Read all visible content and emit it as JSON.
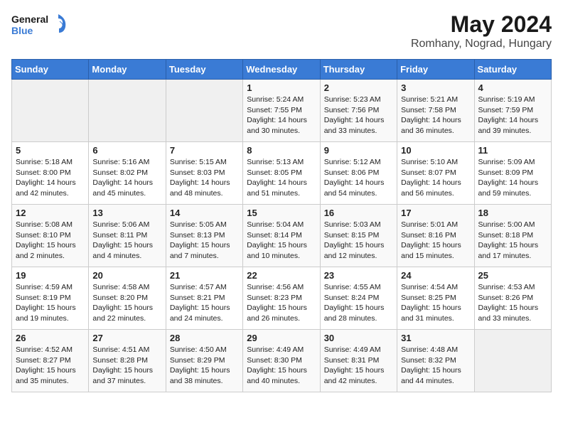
{
  "header": {
    "logo_line1": "General",
    "logo_line2": "Blue",
    "title": "May 2024",
    "subtitle": "Romhany, Nograd, Hungary"
  },
  "weekdays": [
    "Sunday",
    "Monday",
    "Tuesday",
    "Wednesday",
    "Thursday",
    "Friday",
    "Saturday"
  ],
  "weeks": [
    [
      {
        "day": "",
        "info": ""
      },
      {
        "day": "",
        "info": ""
      },
      {
        "day": "",
        "info": ""
      },
      {
        "day": "1",
        "info": "Sunrise: 5:24 AM\nSunset: 7:55 PM\nDaylight: 14 hours\nand 30 minutes."
      },
      {
        "day": "2",
        "info": "Sunrise: 5:23 AM\nSunset: 7:56 PM\nDaylight: 14 hours\nand 33 minutes."
      },
      {
        "day": "3",
        "info": "Sunrise: 5:21 AM\nSunset: 7:58 PM\nDaylight: 14 hours\nand 36 minutes."
      },
      {
        "day": "4",
        "info": "Sunrise: 5:19 AM\nSunset: 7:59 PM\nDaylight: 14 hours\nand 39 minutes."
      }
    ],
    [
      {
        "day": "5",
        "info": "Sunrise: 5:18 AM\nSunset: 8:00 PM\nDaylight: 14 hours\nand 42 minutes."
      },
      {
        "day": "6",
        "info": "Sunrise: 5:16 AM\nSunset: 8:02 PM\nDaylight: 14 hours\nand 45 minutes."
      },
      {
        "day": "7",
        "info": "Sunrise: 5:15 AM\nSunset: 8:03 PM\nDaylight: 14 hours\nand 48 minutes."
      },
      {
        "day": "8",
        "info": "Sunrise: 5:13 AM\nSunset: 8:05 PM\nDaylight: 14 hours\nand 51 minutes."
      },
      {
        "day": "9",
        "info": "Sunrise: 5:12 AM\nSunset: 8:06 PM\nDaylight: 14 hours\nand 54 minutes."
      },
      {
        "day": "10",
        "info": "Sunrise: 5:10 AM\nSunset: 8:07 PM\nDaylight: 14 hours\nand 56 minutes."
      },
      {
        "day": "11",
        "info": "Sunrise: 5:09 AM\nSunset: 8:09 PM\nDaylight: 14 hours\nand 59 minutes."
      }
    ],
    [
      {
        "day": "12",
        "info": "Sunrise: 5:08 AM\nSunset: 8:10 PM\nDaylight: 15 hours\nand 2 minutes."
      },
      {
        "day": "13",
        "info": "Sunrise: 5:06 AM\nSunset: 8:11 PM\nDaylight: 15 hours\nand 4 minutes."
      },
      {
        "day": "14",
        "info": "Sunrise: 5:05 AM\nSunset: 8:13 PM\nDaylight: 15 hours\nand 7 minutes."
      },
      {
        "day": "15",
        "info": "Sunrise: 5:04 AM\nSunset: 8:14 PM\nDaylight: 15 hours\nand 10 minutes."
      },
      {
        "day": "16",
        "info": "Sunrise: 5:03 AM\nSunset: 8:15 PM\nDaylight: 15 hours\nand 12 minutes."
      },
      {
        "day": "17",
        "info": "Sunrise: 5:01 AM\nSunset: 8:16 PM\nDaylight: 15 hours\nand 15 minutes."
      },
      {
        "day": "18",
        "info": "Sunrise: 5:00 AM\nSunset: 8:18 PM\nDaylight: 15 hours\nand 17 minutes."
      }
    ],
    [
      {
        "day": "19",
        "info": "Sunrise: 4:59 AM\nSunset: 8:19 PM\nDaylight: 15 hours\nand 19 minutes."
      },
      {
        "day": "20",
        "info": "Sunrise: 4:58 AM\nSunset: 8:20 PM\nDaylight: 15 hours\nand 22 minutes."
      },
      {
        "day": "21",
        "info": "Sunrise: 4:57 AM\nSunset: 8:21 PM\nDaylight: 15 hours\nand 24 minutes."
      },
      {
        "day": "22",
        "info": "Sunrise: 4:56 AM\nSunset: 8:23 PM\nDaylight: 15 hours\nand 26 minutes."
      },
      {
        "day": "23",
        "info": "Sunrise: 4:55 AM\nSunset: 8:24 PM\nDaylight: 15 hours\nand 28 minutes."
      },
      {
        "day": "24",
        "info": "Sunrise: 4:54 AM\nSunset: 8:25 PM\nDaylight: 15 hours\nand 31 minutes."
      },
      {
        "day": "25",
        "info": "Sunrise: 4:53 AM\nSunset: 8:26 PM\nDaylight: 15 hours\nand 33 minutes."
      }
    ],
    [
      {
        "day": "26",
        "info": "Sunrise: 4:52 AM\nSunset: 8:27 PM\nDaylight: 15 hours\nand 35 minutes."
      },
      {
        "day": "27",
        "info": "Sunrise: 4:51 AM\nSunset: 8:28 PM\nDaylight: 15 hours\nand 37 minutes."
      },
      {
        "day": "28",
        "info": "Sunrise: 4:50 AM\nSunset: 8:29 PM\nDaylight: 15 hours\nand 38 minutes."
      },
      {
        "day": "29",
        "info": "Sunrise: 4:49 AM\nSunset: 8:30 PM\nDaylight: 15 hours\nand 40 minutes."
      },
      {
        "day": "30",
        "info": "Sunrise: 4:49 AM\nSunset: 8:31 PM\nDaylight: 15 hours\nand 42 minutes."
      },
      {
        "day": "31",
        "info": "Sunrise: 4:48 AM\nSunset: 8:32 PM\nDaylight: 15 hours\nand 44 minutes."
      },
      {
        "day": "",
        "info": ""
      }
    ]
  ]
}
